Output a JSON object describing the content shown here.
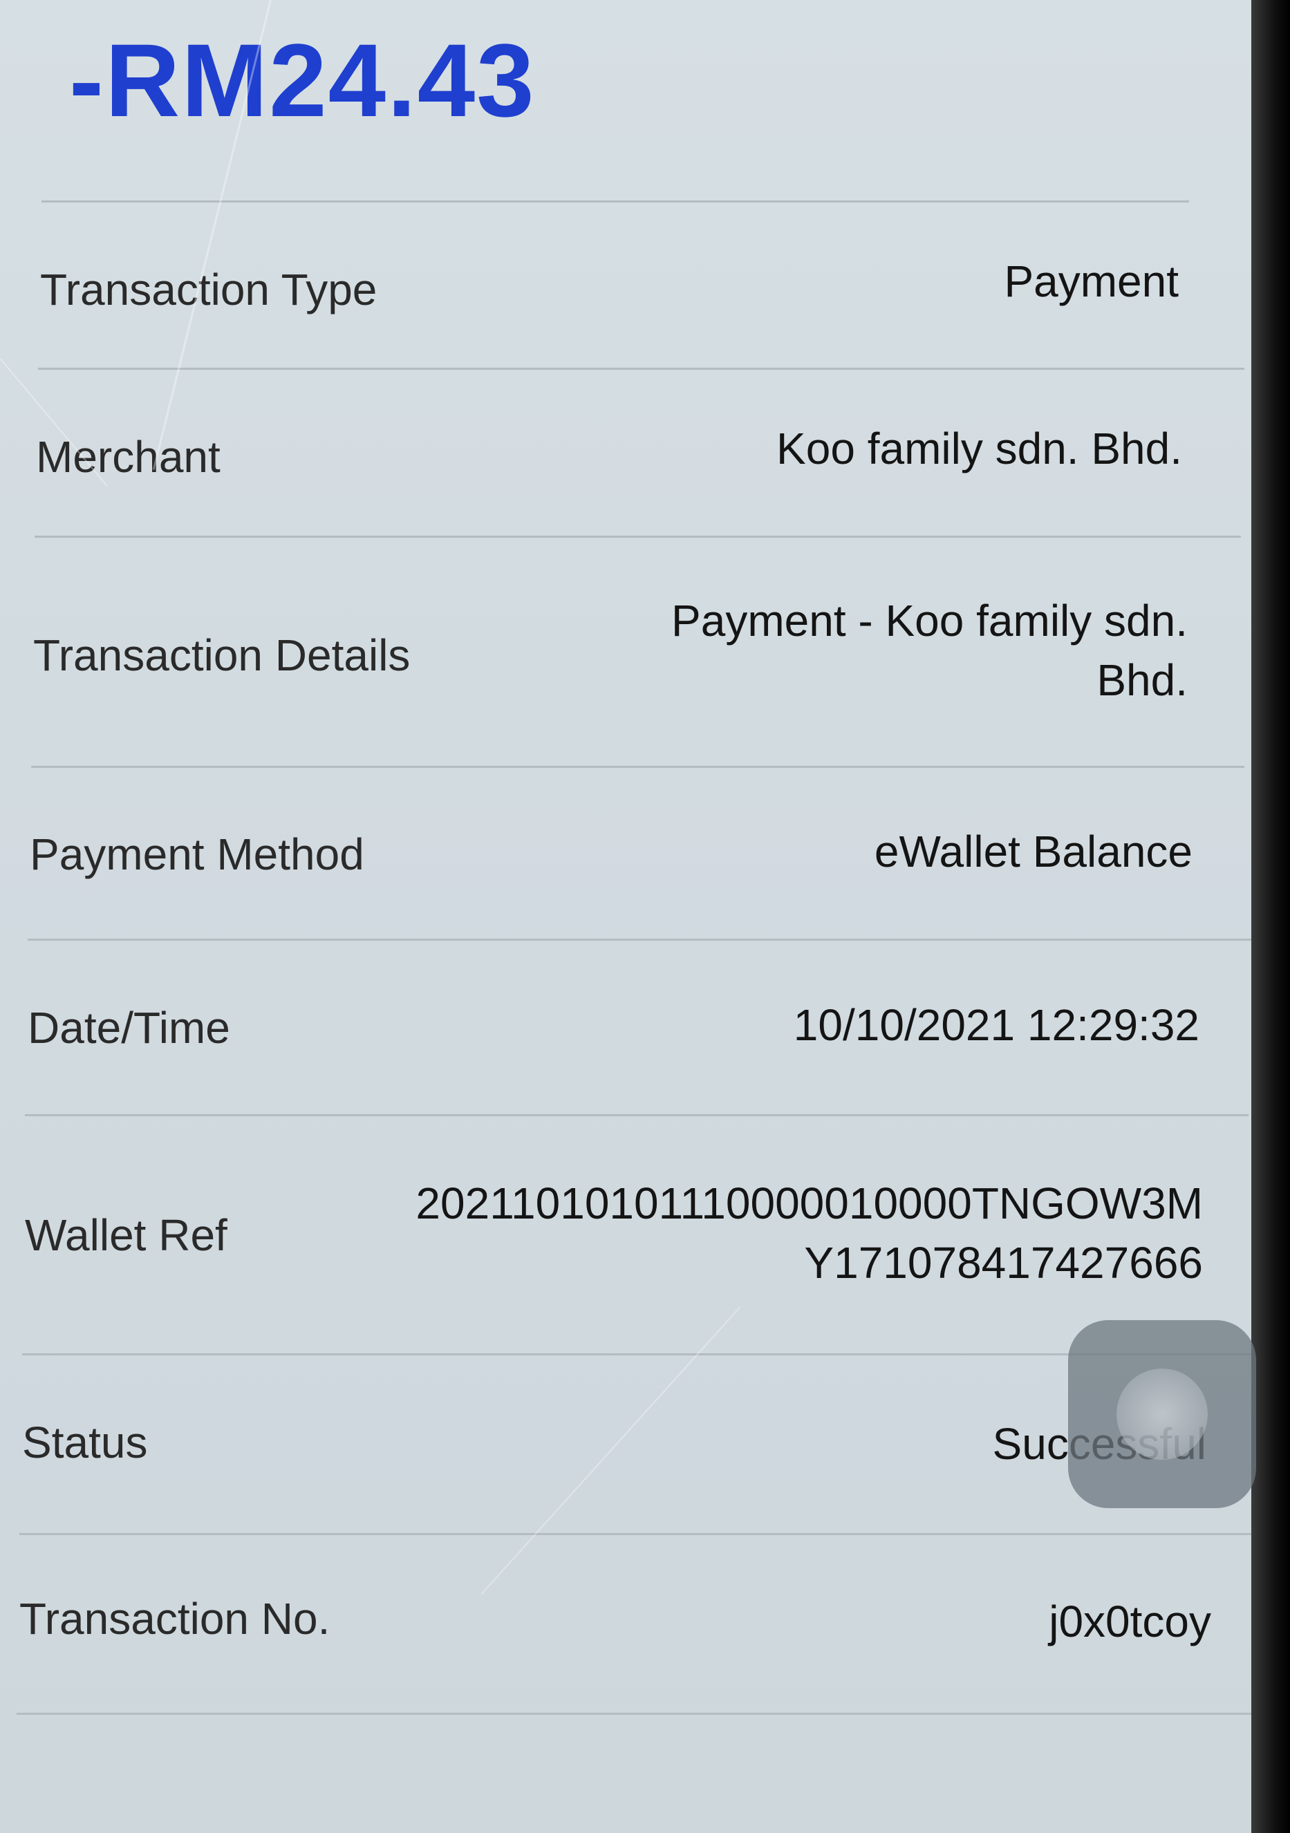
{
  "amount": "-RM24.43",
  "rows": [
    {
      "label": "Transaction Type",
      "value": "Payment"
    },
    {
      "label": "Merchant",
      "value": "Koo family sdn. Bhd."
    },
    {
      "label": "Transaction Details",
      "value_line1": "Payment - Koo family sdn.",
      "value_line2": "Bhd."
    },
    {
      "label": "Payment Method",
      "value": "eWallet Balance"
    },
    {
      "label": "Date/Time",
      "value": "10/10/2021 12:29:32"
    },
    {
      "label": "Wallet Ref",
      "value_line1": "20211010101110000010000TNGOW3M",
      "value_line2": "Y171078417427666"
    },
    {
      "label": "Status",
      "value": "Successful"
    },
    {
      "label": "Transaction No.",
      "value": "j0x0tcoy"
    }
  ],
  "floating_button": {
    "icon": "assistive-touch-icon"
  }
}
